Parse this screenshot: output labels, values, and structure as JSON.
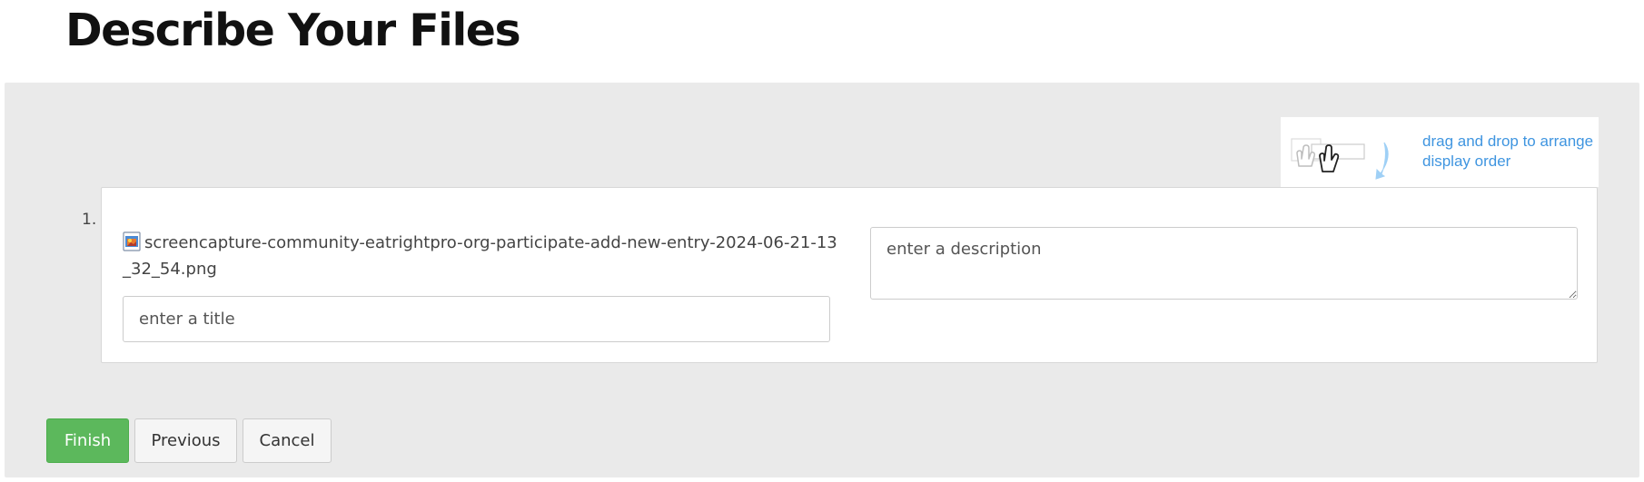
{
  "page": {
    "title": "Describe Your Files"
  },
  "drag_hint": {
    "text": "drag and drop to arrange display order",
    "icon": "drag-drop-hand-icon",
    "color": "#3f95e0"
  },
  "files": [
    {
      "number": "1.",
      "file_icon": "image-file-icon",
      "file_name": "screencapture-community-eatrightpro-org-participate-add-new-entry-2024-06-21-13_32_54.png",
      "title_value": "",
      "title_placeholder": "enter a title",
      "description_value": "",
      "description_placeholder": "enter a description"
    }
  ],
  "buttons": {
    "finish": "Finish",
    "previous": "Previous",
    "cancel": "Cancel"
  },
  "colors": {
    "panel_background": "#eaeaea",
    "finish_button": "#5cb85c",
    "default_button": "#f5f5f5"
  }
}
